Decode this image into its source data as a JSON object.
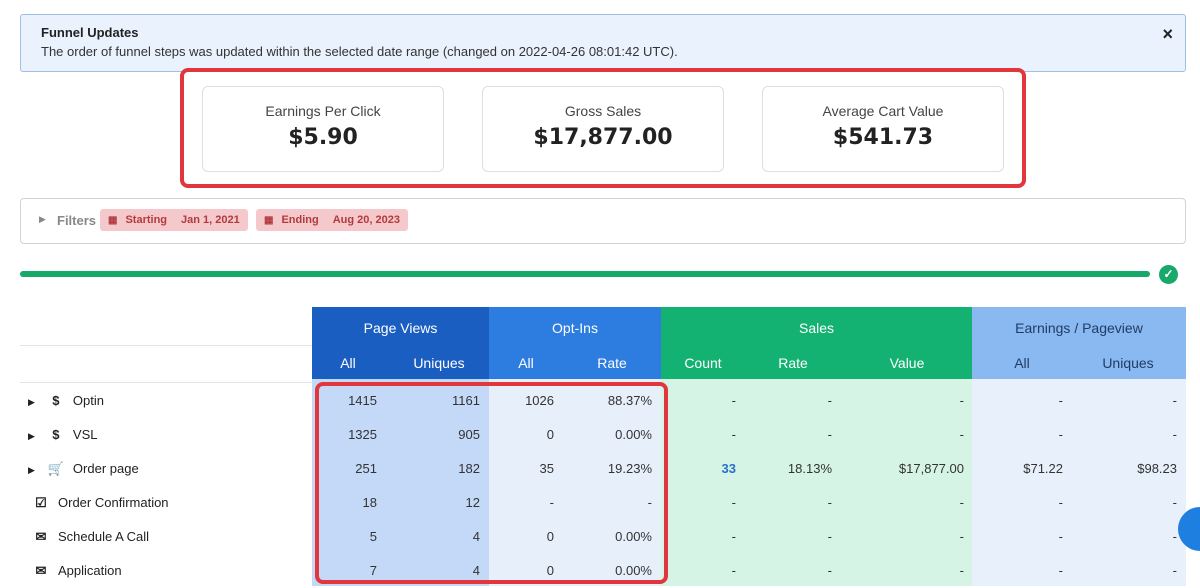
{
  "banner": {
    "title": "Funnel Updates",
    "message": "The order of funnel steps was updated within the selected date range (changed on 2022-04-26 08:01:42 UTC).",
    "close_icon": "×"
  },
  "stats": [
    {
      "label": "Earnings Per Click",
      "value": "$5.90"
    },
    {
      "label": "Gross Sales",
      "value": "$17,877.00"
    },
    {
      "label": "Average Cart Value",
      "value": "$541.73"
    }
  ],
  "filters": {
    "label": "Filters",
    "starting_label": "Starting",
    "starting_date": "Jan 1, 2021",
    "ending_label": "Ending",
    "ending_date": "Aug 20, 2023"
  },
  "progress": {
    "fraction": 1.0
  },
  "table": {
    "groups": [
      {
        "title": "Page Views",
        "color": "#1b5ec2",
        "subs": [
          "All",
          "Uniques"
        ]
      },
      {
        "title": "Opt-Ins",
        "color": "#2d7de0",
        "subs": [
          "All",
          "Rate"
        ]
      },
      {
        "title": "Sales",
        "color": "#13b272",
        "subs": [
          "Count",
          "Rate",
          "Value"
        ]
      },
      {
        "title": "Earnings / Pageview",
        "color": "#8ab8f0",
        "subs": [
          "All",
          "Uniques"
        ]
      }
    ],
    "rows": [
      {
        "icon": "dollar-icon",
        "glyph": "$",
        "expandable": true,
        "label": "Optin",
        "pv_all": "1415",
        "pv_uniq": "1161",
        "opt_all": "1026",
        "opt_rate": "88.37%",
        "s_count": "-",
        "s_rate": "-",
        "s_value": "-",
        "e_all": "-",
        "e_uniq": "-"
      },
      {
        "icon": "dollar-icon",
        "glyph": "$",
        "expandable": true,
        "label": "VSL",
        "pv_all": "1325",
        "pv_uniq": "905",
        "opt_all": "0",
        "opt_rate": "0.00%",
        "s_count": "-",
        "s_rate": "-",
        "s_value": "-",
        "e_all": "-",
        "e_uniq": "-"
      },
      {
        "icon": "cart-icon",
        "glyph": "🛒",
        "expandable": true,
        "label": "Order page",
        "pv_all": "251",
        "pv_uniq": "182",
        "opt_all": "35",
        "opt_rate": "19.23%",
        "s_count": "33",
        "s_rate": "18.13%",
        "s_value": "$17,877.00",
        "e_all": "$71.22",
        "e_uniq": "$98.23"
      },
      {
        "icon": "checkbox-icon",
        "glyph": "☑",
        "expandable": false,
        "label": "Order Confirmation",
        "pv_all": "18",
        "pv_uniq": "12",
        "opt_all": "-",
        "opt_rate": "-",
        "s_count": "-",
        "s_rate": "-",
        "s_value": "-",
        "e_all": "-",
        "e_uniq": "-"
      },
      {
        "icon": "envelope-icon",
        "glyph": "✉",
        "expandable": false,
        "label": "Schedule A Call",
        "pv_all": "5",
        "pv_uniq": "4",
        "opt_all": "0",
        "opt_rate": "0.00%",
        "s_count": "-",
        "s_rate": "-",
        "s_value": "-",
        "e_all": "-",
        "e_uniq": "-"
      },
      {
        "icon": "envelope-icon",
        "glyph": "✉",
        "expandable": false,
        "label": "Application",
        "pv_all": "7",
        "pv_uniq": "4",
        "opt_all": "0",
        "opt_rate": "0.00%",
        "s_count": "-",
        "s_rate": "-",
        "s_value": "-",
        "e_all": "-",
        "e_uniq": "-"
      }
    ]
  }
}
